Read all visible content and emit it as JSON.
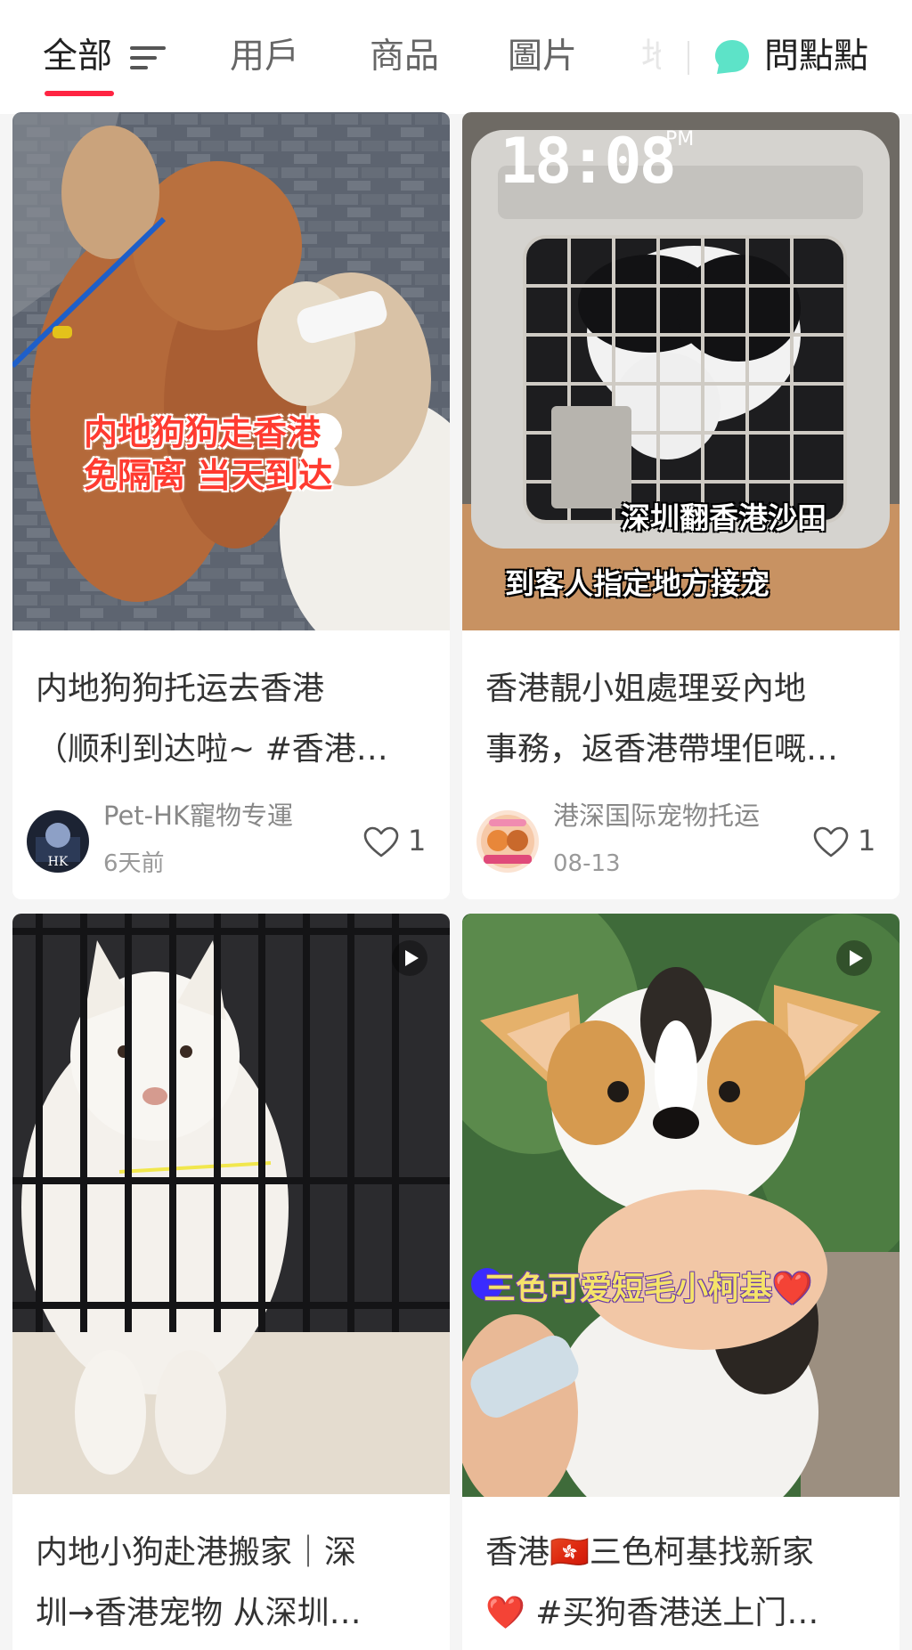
{
  "tabs": {
    "all": "全部",
    "users": "用戶",
    "products": "商品",
    "images": "圖片",
    "more_peek": "地",
    "ask": "問點點"
  },
  "colors": {
    "accent": "#ff2442",
    "ask_icon": "#5de3c8",
    "like_icon": "#555555"
  },
  "icons": {
    "filter": "filter-lines-icon",
    "ask": "chat-bubble-icon",
    "like": "heart-outline-icon",
    "play": "play-icon"
  },
  "posts": [
    {
      "overlay_lines": [
        "内地狗狗走香港",
        "免隔离 当天到达"
      ],
      "title_lines": [
        "内地狗狗托运去香港",
        "（顺利到达啦~ #香港…"
      ],
      "author": "Pet-HK寵物专運",
      "date": "6天前",
      "likes": "1",
      "avatar_text": "HK"
    },
    {
      "overlay_clock": "18:08",
      "overlay_clock_suffix": "PM",
      "overlay_lines": [
        "深圳翻香港沙田",
        "到客人指定地方接宠"
      ],
      "title_lines": [
        "香港靚小姐處理妥內地",
        "事務，返香港帶埋佢嘅…"
      ],
      "author": "港深国际宠物托运",
      "date": "08-13",
      "likes": "1"
    },
    {
      "title_lines": [
        "内地小狗赴港搬家｜深",
        "圳→香港宠物 从深圳…"
      ]
    },
    {
      "overlay_lines": [
        "三色可爱短毛小柯基❤️"
      ],
      "title_lines": [
        "香港🇭🇰三色柯基找新家",
        "❤️ #买狗香港送上门…"
      ]
    }
  ]
}
